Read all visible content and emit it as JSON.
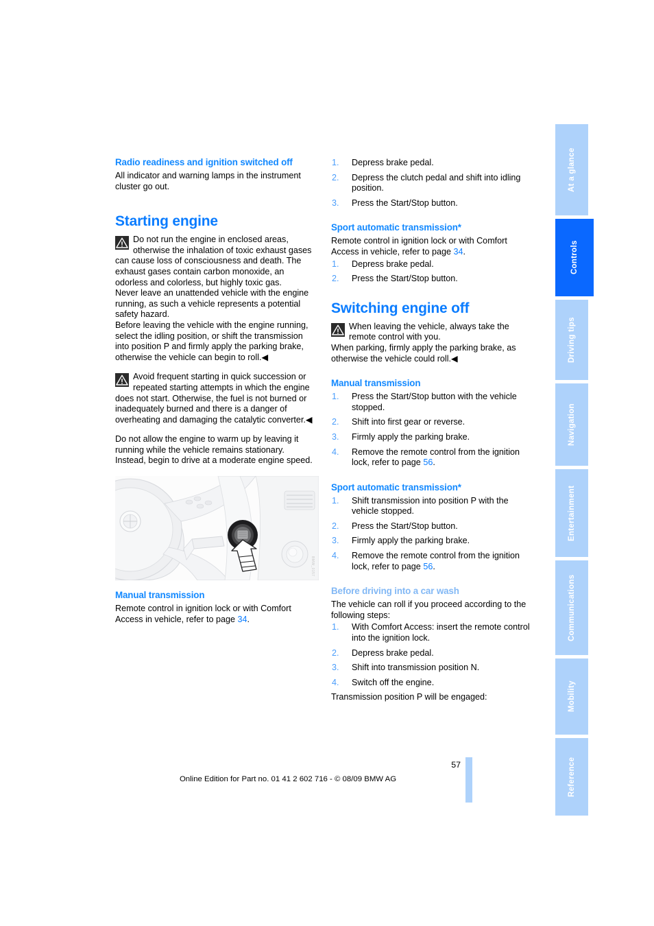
{
  "document": {
    "page_number": "57",
    "footer_text": "Online Edition for Part no. 01 41 2 602 716 - © 08/09 BMW AG",
    "figure_code": "BMW_0157"
  },
  "colors": {
    "heading_blue": "#0a7cff",
    "subheading_blue": "#1389ff",
    "pale_blue": "#82b8f5",
    "tab_inactive": "#aed2fb",
    "tab_active": "#0a68ff",
    "list_number": "#4a9dfb"
  },
  "left_column": {
    "radio_heading": "Radio readiness and ignition switched off",
    "radio_body": "All indicator and warning lamps in the instrument cluster go out.",
    "starting_engine_heading": "Starting engine",
    "warning_1": {
      "icon": "warning-triangle-icon",
      "lead": "Do not run the engine in enclosed areas, otherwise the inhalation of toxic exhaust gases can cause loss of consciousness and death. The exhaust gases contain carbon monoxide, an odorless and colorless, but highly toxic gas.",
      "para_2": "Never leave an unattended vehicle with the engine running, as such a vehicle represents a potential safety hazard.",
      "para_3": "Before leaving the vehicle with the engine running, select the idling position, or shift the transmission into position P and firmly apply the parking brake, otherwise the vehicle can begin to roll.◀"
    },
    "warning_2": {
      "icon": "warning-triangle-icon",
      "lead": "Avoid frequent starting in quick succession or repeated starting attempts in which the engine does not start. Otherwise, the fuel is not burned or inadequately burned and there is a danger of overheating and damaging the catalytic converter.◀"
    },
    "warmup_para": "Do not allow the engine to warm up by leaving it running while the vehicle remains stationary. Instead, begin to drive at a moderate engine speed.",
    "figure_alt": "steering-wheel-ignition-lock-illustration",
    "manual_transmission_heading": "Manual transmission",
    "manual_transmission_body_before": "Remote control in ignition lock or with Comfort Access in vehicle, refer to page ",
    "manual_transmission_pageref": "34",
    "manual_transmission_body_after": "."
  },
  "right_column": {
    "manual_steps": [
      "Depress brake pedal.",
      "Depress the clutch pedal and shift into idling position.",
      "Press the Start/Stop button."
    ],
    "sport_auto_start_heading": "Sport automatic transmission*",
    "sport_auto_start_intro_before": "Remote control in ignition lock or with Comfort Access in vehicle, refer to page ",
    "sport_auto_start_pageref": "34",
    "sport_auto_start_intro_after": ".",
    "sport_auto_start_steps": [
      "Depress brake pedal.",
      "Press the Start/Stop button."
    ],
    "switching_off_heading": "Switching engine off",
    "switching_off_warning": {
      "icon": "warning-triangle-icon",
      "lead": "When leaving the vehicle, always take the remote control with you.",
      "para_2": "When parking, firmly apply the parking brake, as otherwise the vehicle could roll.◀"
    },
    "manual_off_heading": "Manual transmission",
    "manual_off_steps": [
      "Press the Start/Stop button with the vehicle stopped.",
      "Shift into first gear or reverse.",
      "Firmly apply the parking brake.",
      "Remove the remote control from the ignition lock, refer to page 56."
    ],
    "manual_off_step4_pageref": "56",
    "sport_auto_off_heading": "Sport automatic transmission*",
    "sport_auto_off_steps": [
      "Shift transmission into position P with the vehicle stopped.",
      "Press the Start/Stop button.",
      "Firmly apply the parking brake.",
      "Remove the remote control from the ignition lock, refer to page 56."
    ],
    "sport_auto_off_step4_pageref": "56",
    "car_wash_heading": "Before driving into a car wash",
    "car_wash_intro": "The vehicle can roll if you proceed according to the following steps:",
    "car_wash_steps": [
      "With Comfort Access: insert the remote control into the ignition lock.",
      "Depress brake pedal.",
      "Shift into transmission position N.",
      "Switch off the engine."
    ],
    "car_wash_outro": "Transmission position P will be engaged:"
  },
  "tab_rail": {
    "tabs": [
      {
        "label": "At a glance",
        "active": false
      },
      {
        "label": "Controls",
        "active": true
      },
      {
        "label": "Driving tips",
        "active": false
      },
      {
        "label": "Navigation",
        "active": false
      },
      {
        "label": "Entertainment",
        "active": false
      },
      {
        "label": "Communications",
        "active": false
      },
      {
        "label": "Mobility",
        "active": false
      },
      {
        "label": "Reference",
        "active": false
      }
    ]
  }
}
